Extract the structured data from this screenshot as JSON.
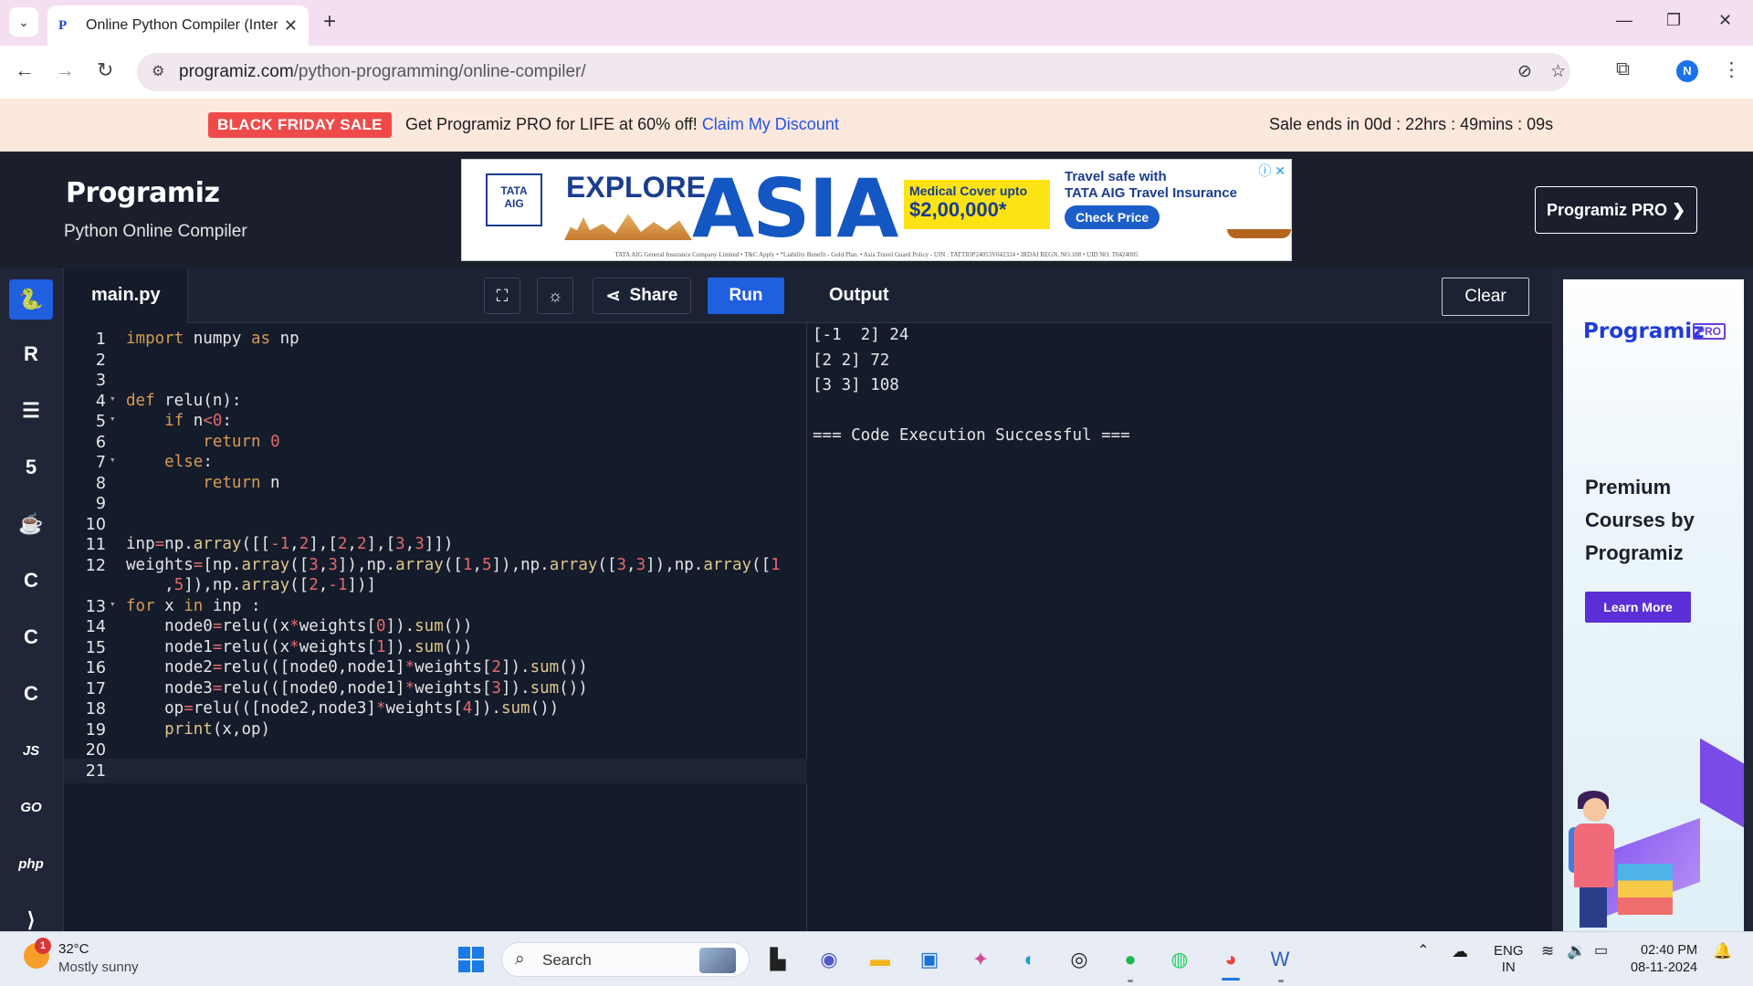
{
  "browser": {
    "tab_title": "Online Python Compiler (Interp",
    "url_domain": "programiz.com",
    "url_path": "/python-programming/online-compiler/",
    "profile_initial": "N"
  },
  "promo": {
    "badge": "BLACK FRIDAY SALE",
    "text": "Get Programiz PRO for LIFE at 60% off!",
    "link": "Claim My Discount",
    "countdown": "Sale ends in 00d : 22hrs : 49mins : 09s"
  },
  "header": {
    "logo": "Programiz",
    "subtitle": "Python Online Compiler",
    "pro_button": "Programiz PRO ❯"
  },
  "ad": {
    "brand_line1": "TATA",
    "brand_line2": "AIG",
    "explore": "EXPLORE",
    "asia": "ASIA",
    "medical_line1": "Medical Cover upto",
    "medical_line2": "$2,00,000*",
    "travel_line1": "Travel safe with",
    "travel_line2": "TATA AIG Travel Insurance",
    "cta": "Check Price",
    "disclaimer": "TATA AIG General Insurance Company Limited • T&C Apply • *Liability Benefit - Gold Plan. • Asia Travel Guard Policy - UIN : TATTIOP24053V042324 • IRDAI REGN. NO.108 • UID NO. T0424005"
  },
  "sidebar": {
    "items": [
      {
        "name": "python",
        "label": "🐍"
      },
      {
        "name": "r",
        "label": "R"
      },
      {
        "name": "sql",
        "label": "☰"
      },
      {
        "name": "html",
        "label": "5"
      },
      {
        "name": "java",
        "label": "☕"
      },
      {
        "name": "c",
        "label": "C"
      },
      {
        "name": "cpp",
        "label": "C"
      },
      {
        "name": "csharp",
        "label": "C"
      },
      {
        "name": "js",
        "label": "JS"
      },
      {
        "name": "go",
        "label": "GO"
      },
      {
        "name": "php",
        "label": "php"
      },
      {
        "name": "swift",
        "label": "⟩"
      }
    ]
  },
  "editor": {
    "filename": "main.py",
    "share_label": "Share",
    "run_label": "Run",
    "lines": [
      {
        "n": "1",
        "fold": false,
        "code": "<span class=\"kw\">import</span> numpy <span class=\"kw\">as</span> np"
      },
      {
        "n": "2",
        "fold": false,
        "code": ""
      },
      {
        "n": "3",
        "fold": false,
        "code": ""
      },
      {
        "n": "4",
        "fold": true,
        "code": "<span class=\"kw\">def</span> relu(n):"
      },
      {
        "n": "5",
        "fold": true,
        "code": "    <span class=\"kw\">if</span> n<span class=\"op\">&lt;</span><span class=\"num\">0</span>:"
      },
      {
        "n": "6",
        "fold": false,
        "code": "        <span class=\"kw\">return</span> <span class=\"num\">0</span>"
      },
      {
        "n": "7",
        "fold": true,
        "code": "    <span class=\"kw\">else</span>:"
      },
      {
        "n": "8",
        "fold": false,
        "code": "        <span class=\"kw\">return</span> n"
      },
      {
        "n": "9",
        "fold": false,
        "code": ""
      },
      {
        "n": "10",
        "fold": false,
        "code": ""
      },
      {
        "n": "11",
        "fold": false,
        "code": "inp<span class=\"op\">=</span>np.<span class=\"fn\">array</span>([[<span class=\"op\">-</span><span class=\"num\">1</span>,<span class=\"num\">2</span>],[<span class=\"num\">2</span>,<span class=\"num\">2</span>],[<span class=\"num\">3</span>,<span class=\"num\">3</span>]])"
      },
      {
        "n": "12",
        "fold": false,
        "code": "weights<span class=\"op\">=</span>[np.<span class=\"fn\">array</span>([<span class=\"num\">3</span>,<span class=\"num\">3</span>]),np.<span class=\"fn\">array</span>([<span class=\"num\">1</span>,<span class=\"num\">5</span>]),np.<span class=\"fn\">array</span>([<span class=\"num\">3</span>,<span class=\"num\">3</span>]),np.<span class=\"fn\">array</span>([<span class=\"num\">1</span>"
      },
      {
        "n": "",
        "fold": false,
        "code": "    ,<span class=\"num\">5</span>]),np.<span class=\"fn\">array</span>([<span class=\"num\">2</span>,<span class=\"op\">-</span><span class=\"num\">1</span>])]"
      },
      {
        "n": "13",
        "fold": true,
        "code": "<span class=\"kw\">for</span> x <span class=\"kw\">in</span> inp :"
      },
      {
        "n": "14",
        "fold": false,
        "code": "    node0<span class=\"op\">=</span>relu((x<span class=\"op\">*</span>weights[<span class=\"num\">0</span>]).<span class=\"fn\">sum</span>())"
      },
      {
        "n": "15",
        "fold": false,
        "code": "    node1<span class=\"op\">=</span>relu((x<span class=\"op\">*</span>weights[<span class=\"num\">1</span>]).<span class=\"fn\">sum</span>())"
      },
      {
        "n": "16",
        "fold": false,
        "code": "    node2<span class=\"op\">=</span>relu(([node0,node1]<span class=\"op\">*</span>weights[<span class=\"num\">2</span>]).<span class=\"fn\">sum</span>())"
      },
      {
        "n": "17",
        "fold": false,
        "code": "    node3<span class=\"op\">=</span>relu(([node0,node1]<span class=\"op\">*</span>weights[<span class=\"num\">3</span>]).<span class=\"fn\">sum</span>())"
      },
      {
        "n": "18",
        "fold": false,
        "code": "    op<span class=\"op\">=</span>relu(([node2,node3]<span class=\"op\">*</span>weights[<span class=\"num\">4</span>]).<span class=\"fn\">sum</span>())"
      },
      {
        "n": "19",
        "fold": false,
        "code": "    <span class=\"fn\">print</span>(x,op)"
      },
      {
        "n": "20",
        "fold": false,
        "code": ""
      },
      {
        "n": "21",
        "fold": false,
        "code": "",
        "active": true
      }
    ]
  },
  "output": {
    "title": "Output",
    "clear_label": "Clear",
    "lines": [
      "[-1  2] 24",
      "[2 2] 72",
      "[3 3] 108",
      "",
      "=== Code Execution Successful ==="
    ]
  },
  "right_ad": {
    "logo": "Programiz",
    "pro": "PRO",
    "headline": "Premium Courses by Programiz",
    "cta": "Learn More"
  },
  "taskbar": {
    "weather_alert": "1",
    "temperature": "32°C",
    "condition": "Mostly sunny",
    "search_placeholder": "Search",
    "lang_line1": "ENG",
    "lang_line2": "IN",
    "time": "02:40 PM",
    "date": "08-11-2024"
  }
}
